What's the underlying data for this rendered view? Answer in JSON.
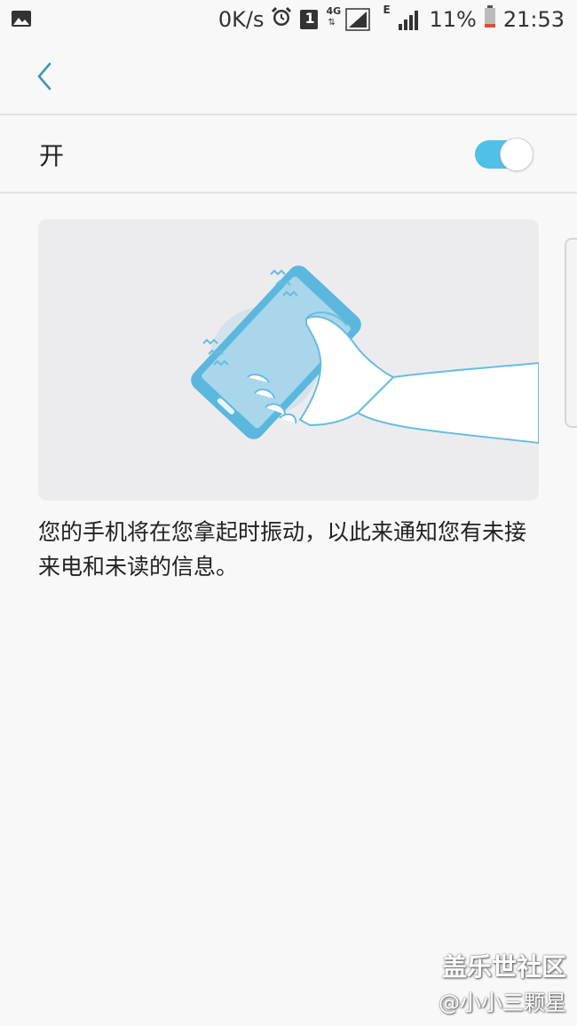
{
  "status_bar": {
    "speed": "0K/s",
    "sim_badge": "1",
    "network_4g": "4G",
    "network_e": "E",
    "battery": "11%",
    "time": "21:53",
    "left_icon": "image-icon",
    "alarm_icon": "alarm-icon"
  },
  "header": {
    "back_icon": "chevron-left-icon"
  },
  "master_switch": {
    "label": "开",
    "state": true
  },
  "description": "您的手机将在您拿起时振动，以此来通知您有未接来电和未读的信息。",
  "watermark": {
    "title": "盖乐世社区",
    "user": "@小小三颗星"
  },
  "colors": {
    "accent": "#4fc1e9",
    "back_arrow": "#3b97b8",
    "background": "#f8f8f8",
    "card_background": "#ececee",
    "phone_body": "#5bb7dd",
    "phone_screen": "#a9d6ea"
  }
}
